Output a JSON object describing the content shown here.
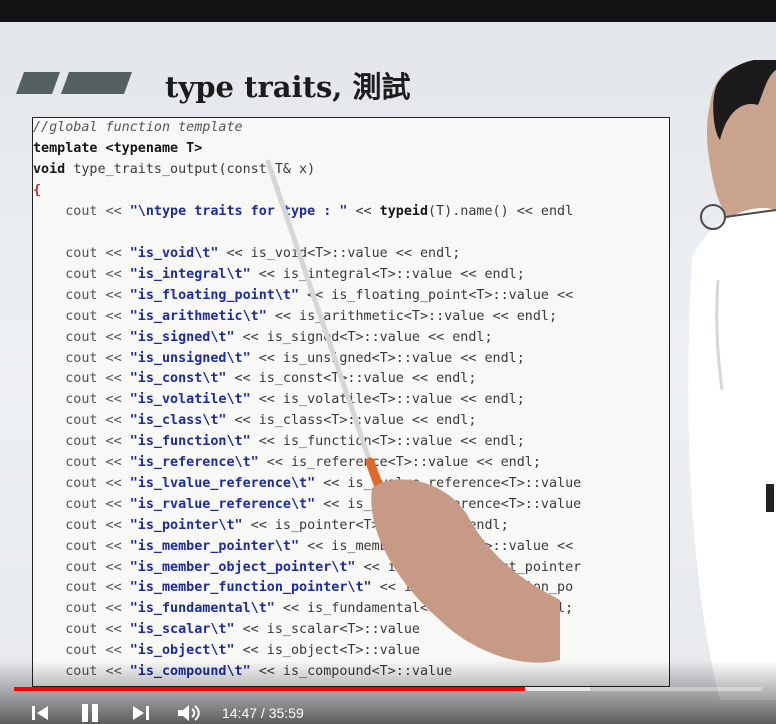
{
  "slide": {
    "title": "type traits, 測試",
    "code": {
      "header": [
        {
          "cls": "c-comment",
          "text": "//global function template"
        },
        {
          "cls": "c-kw",
          "text": "template <typename T>"
        }
      ],
      "decl": {
        "kw": "void ",
        "fn": "type_traits_output",
        "params": "(const T& x)"
      },
      "brace": "{",
      "first": {
        "pre": "    cout << ",
        "str": "\"\\ntype traits for type : \"",
        "mid": " << ",
        "kw": "typeid",
        "post": "(T).name() << endl"
      },
      "rows": [
        {
          "str": "\"is_void\\t\"",
          "rest": " << is_void<T>::value << endl;"
        },
        {
          "str": "\"is_integral\\t\"",
          "rest": " << is_integral<T>::value << endl;"
        },
        {
          "str": "\"is_floating_point\\t\"",
          "rest": " << is_floating_point<T>::value <<"
        },
        {
          "str": "\"is_arithmetic\\t\"",
          "rest": " << is_arithmetic<T>::value << endl;"
        },
        {
          "str": "\"is_signed\\t\"",
          "rest": " << is_signed<T>::value << endl;"
        },
        {
          "str": "\"is_unsigned\\t\"",
          "rest": " << is_unsigned<T>::value << endl;"
        },
        {
          "str": "\"is_const\\t\"",
          "rest": " << is_const<T>::value << endl;"
        },
        {
          "str": "\"is_volatile\\t\"",
          "rest": " << is_volatile<T>::value << endl;"
        },
        {
          "str": "\"is_class\\t\"",
          "rest": " << is_class<T>::value << endl;"
        },
        {
          "str": "\"is_function\\t\"",
          "rest": " << is_function<T>::value << endl;"
        },
        {
          "str": "\"is_reference\\t\"",
          "rest": " << is_reference<T>::value << endl;"
        },
        {
          "str": "\"is_lvalue_reference\\t\"",
          "rest": " << is_lvalue_reference<T>::value"
        },
        {
          "str": "\"is_rvalue_reference\\t\"",
          "rest": " << is_rvalue_reference<T>::value"
        },
        {
          "str": "\"is_pointer\\t\"",
          "rest": " << is_pointer<T>::value << endl;"
        },
        {
          "str": "\"is_member_pointer\\t\"",
          "rest": " << is_member_pointer<T>::value <<"
        },
        {
          "str": "\"is_member_object_pointer\\t\"",
          "rest": " << is_member_object_pointer"
        },
        {
          "str": "\"is_member_function_pointer\\t\"",
          "rest": " << is_member_function_po"
        },
        {
          "str": "\"is_fundamental\\t\"",
          "rest": " << is_fundamental<T>::value << endl;"
        },
        {
          "str": "\"is_scalar\\t\"",
          "rest": " << is_scalar<T>::value"
        },
        {
          "str": "\"is_object\\t\"",
          "rest": " << is_object<T>::value"
        },
        {
          "str": "\"is_compound\\t\"",
          "rest": " << is_compound<T>::value"
        }
      ],
      "cout": "    cout << "
    }
  },
  "player": {
    "time": "14:47 / 35:59",
    "progress": 0.683,
    "buffered": 0.77,
    "accent": "#ff0000",
    "icons": [
      "previous-icon",
      "pause-icon",
      "next-icon",
      "volume-icon"
    ]
  }
}
